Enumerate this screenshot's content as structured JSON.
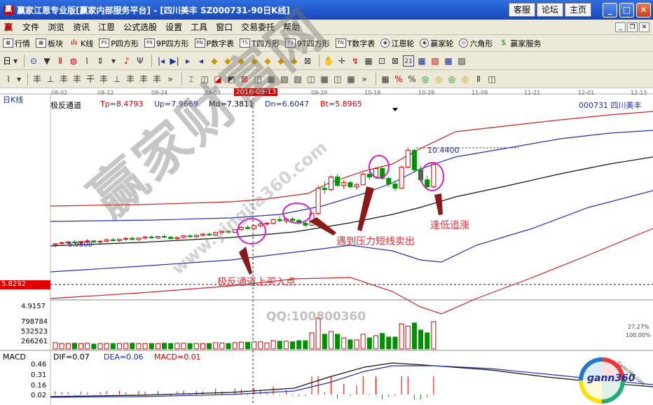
{
  "window": {
    "title": "赢家江恩专业版[赢家内部服务平台] - [四川美丰   SZ000731-90日K线]",
    "buttons": [
      "客服",
      "论坛",
      "主页"
    ]
  },
  "menu": {
    "items": [
      "文件",
      "浏览",
      "资讯",
      "江恩",
      "公式选股",
      "设置",
      "工具",
      "窗口",
      "交易委托",
      "帮助"
    ]
  },
  "toolbar1": {
    "items": [
      {
        "icon": "grid",
        "label": "行情"
      },
      {
        "icon": "blocks",
        "label": "板块"
      },
      {
        "icon": "kline",
        "label": "K线"
      },
      {
        "icon": "P",
        "label": "P四方形"
      },
      {
        "icon": "9P",
        "label": "9P四方形"
      },
      {
        "icon": "P",
        "label": "P数字表"
      },
      {
        "icon": "T",
        "label": "T四方形"
      },
      {
        "icon": "T9",
        "label": "9T四方形"
      },
      {
        "icon": "TN",
        "label": "T数字表"
      },
      {
        "icon": "wheel",
        "label": "江恩轮"
      },
      {
        "icon": "wheel",
        "label": "赢家轮"
      },
      {
        "icon": "hex",
        "label": "六角形"
      },
      {
        "icon": "$",
        "label": "赢家服务"
      }
    ]
  },
  "toolbar2": {
    "period": "日",
    "glyphs": [
      "⊙",
      "▼",
      "Ⅱ",
      "◍",
      "⌇",
      "⇕",
      "▾",
      "♪",
      "Ψ",
      "|◂",
      "▶|",
      "▸",
      "◂",
      "◆",
      "◆",
      "◆",
      "◆",
      "◆",
      "◆",
      "◆",
      "⊠",
      "✋",
      "✛",
      "↯",
      "▦",
      "⊡",
      "⊠",
      "21",
      "▦",
      "▧",
      "▩",
      "▨"
    ]
  },
  "toolbar3": {
    "glyphs": [
      "⌇",
      "▾",
      "丰",
      "⊥",
      "丰",
      "丰",
      "干",
      "丰",
      "⊥",
      "丰",
      "丰",
      "丰",
      "»",
      "⌶",
      "◫",
      "◪",
      "◩",
      "⊠",
      "◫",
      "▦",
      "▧",
      "▧",
      "◫",
      "▩",
      "◫",
      "▦",
      "»",
      "▦",
      "%",
      "%",
      "◎",
      "◎",
      "◎",
      "◎",
      "Ⅱ",
      "◫"
    ]
  },
  "chart": {
    "period_label": "日K线",
    "indicator_name": "极反通道",
    "tp": "Tp=8.4793",
    "up": "Up=7.9669",
    "md": "Md=7.3811",
    "dn": "Dn=6.6047",
    "bt": "Bt=5.8965",
    "stock": "000731  四川美丰",
    "dates": [
      "08-02",
      "08-12",
      "08-24",
      "09-05",
      "2016-09-13",
      "09-29",
      "10-18",
      "10-28",
      "11-09",
      "11-21",
      "12-01",
      "12-13"
    ],
    "high_label": "10.4400",
    "low_label": "6.9800",
    "cursor_price": "5.8292",
    "axis_price": "4.9157",
    "volume_ticks": [
      "798784",
      "532523",
      "266261"
    ],
    "pct_top": "27.27%",
    "pct_bottom": "100.00%",
    "watermark_main": "赢家财富网",
    "watermark_url": "www.yingjia360.com",
    "qq": "QQ:100800360",
    "annotations": {
      "buy_entry": "极反通道上买入点",
      "sell_pressure": "遇到压力短线卖出",
      "dip_buy": "逢低追涨"
    },
    "macd": {
      "name": "MACD",
      "dif": "DIF=0.07",
      "dea": "DEA=0.06",
      "macd": "MACD=0.01",
      "ticks": [
        "0.46",
        "0.31",
        "0.16",
        "0.02"
      ]
    },
    "logo": "gann360",
    "logo_ring": "Gann360.com"
  },
  "chart_data": {
    "type": "candlestick",
    "candles": [
      {
        "o": 6.98,
        "h": 7.05,
        "l": 6.9,
        "c": 7.02
      },
      {
        "o": 7.02,
        "h": 7.1,
        "l": 6.98,
        "c": 7.05
      },
      {
        "o": 7.05,
        "h": 7.12,
        "l": 7.0,
        "c": 7.08
      },
      {
        "o": 7.08,
        "h": 7.15,
        "l": 7.02,
        "c": 7.06
      },
      {
        "o": 7.06,
        "h": 7.12,
        "l": 7.0,
        "c": 7.1
      },
      {
        "o": 7.1,
        "h": 7.18,
        "l": 7.05,
        "c": 7.12
      },
      {
        "o": 7.12,
        "h": 7.15,
        "l": 7.05,
        "c": 7.08
      },
      {
        "o": 7.08,
        "h": 7.14,
        "l": 7.02,
        "c": 7.11
      },
      {
        "o": 7.11,
        "h": 7.2,
        "l": 7.08,
        "c": 7.16
      },
      {
        "o": 7.16,
        "h": 7.22,
        "l": 7.1,
        "c": 7.13
      },
      {
        "o": 7.13,
        "h": 7.2,
        "l": 7.08,
        "c": 7.18
      },
      {
        "o": 7.18,
        "h": 7.25,
        "l": 7.12,
        "c": 7.21
      },
      {
        "o": 7.21,
        "h": 7.28,
        "l": 7.15,
        "c": 7.17
      },
      {
        "o": 7.17,
        "h": 7.24,
        "l": 7.12,
        "c": 7.22
      },
      {
        "o": 7.22,
        "h": 7.3,
        "l": 7.18,
        "c": 7.26
      },
      {
        "o": 7.26,
        "h": 7.32,
        "l": 7.2,
        "c": 7.23
      },
      {
        "o": 7.23,
        "h": 7.3,
        "l": 7.18,
        "c": 7.28
      },
      {
        "o": 7.28,
        "h": 7.35,
        "l": 7.22,
        "c": 7.25
      },
      {
        "o": 7.25,
        "h": 7.3,
        "l": 7.18,
        "c": 7.2
      },
      {
        "o": 7.2,
        "h": 7.28,
        "l": 7.15,
        "c": 7.24
      },
      {
        "o": 7.24,
        "h": 7.33,
        "l": 7.2,
        "c": 7.3
      },
      {
        "o": 7.3,
        "h": 7.36,
        "l": 7.24,
        "c": 7.27
      },
      {
        "o": 7.27,
        "h": 7.34,
        "l": 7.22,
        "c": 7.32
      },
      {
        "o": 7.32,
        "h": 7.4,
        "l": 7.28,
        "c": 7.36
      },
      {
        "o": 7.36,
        "h": 7.42,
        "l": 7.3,
        "c": 7.33
      },
      {
        "o": 7.33,
        "h": 7.45,
        "l": 7.3,
        "c": 7.42
      },
      {
        "o": 7.42,
        "h": 7.5,
        "l": 7.36,
        "c": 7.46
      },
      {
        "o": 7.46,
        "h": 7.52,
        "l": 7.4,
        "c": 7.43
      },
      {
        "o": 7.43,
        "h": 7.55,
        "l": 7.4,
        "c": 7.52
      },
      {
        "o": 7.52,
        "h": 7.65,
        "l": 7.48,
        "c": 7.6
      },
      {
        "o": 7.6,
        "h": 7.68,
        "l": 7.52,
        "c": 7.56
      },
      {
        "o": 7.56,
        "h": 7.7,
        "l": 7.52,
        "c": 7.66
      },
      {
        "o": 7.66,
        "h": 7.78,
        "l": 7.6,
        "c": 7.72
      },
      {
        "o": 7.72,
        "h": 7.8,
        "l": 7.66,
        "c": 7.75
      },
      {
        "o": 7.75,
        "h": 7.92,
        "l": 7.7,
        "c": 7.88
      },
      {
        "o": 7.88,
        "h": 8.0,
        "l": 7.8,
        "c": 7.84
      },
      {
        "o": 7.84,
        "h": 7.95,
        "l": 7.75,
        "c": 7.9
      },
      {
        "o": 7.9,
        "h": 7.98,
        "l": 7.8,
        "c": 7.85
      },
      {
        "o": 7.85,
        "h": 7.92,
        "l": 7.7,
        "c": 7.75
      },
      {
        "o": 7.75,
        "h": 7.82,
        "l": 7.6,
        "c": 7.68
      },
      {
        "o": 7.68,
        "h": 8.15,
        "l": 7.65,
        "c": 8.1
      },
      {
        "o": 8.1,
        "h": 9.1,
        "l": 8.05,
        "c": 9.0
      },
      {
        "o": 9.0,
        "h": 9.25,
        "l": 8.8,
        "c": 8.95
      },
      {
        "o": 8.95,
        "h": 9.45,
        "l": 8.9,
        "c": 9.4
      },
      {
        "o": 9.4,
        "h": 9.5,
        "l": 9.05,
        "c": 9.1
      },
      {
        "o": 9.1,
        "h": 9.3,
        "l": 8.98,
        "c": 9.2
      },
      {
        "o": 9.2,
        "h": 9.25,
        "l": 9.0,
        "c": 9.05
      },
      {
        "o": 9.05,
        "h": 9.2,
        "l": 8.95,
        "c": 9.12
      },
      {
        "o": 9.12,
        "h": 9.55,
        "l": 9.1,
        "c": 9.5
      },
      {
        "o": 9.5,
        "h": 9.62,
        "l": 9.3,
        "c": 9.4
      },
      {
        "o": 9.4,
        "h": 9.75,
        "l": 9.35,
        "c": 9.7
      },
      {
        "o": 9.7,
        "h": 9.78,
        "l": 9.3,
        "c": 9.35
      },
      {
        "o": 9.35,
        "h": 9.4,
        "l": 9.05,
        "c": 9.15
      },
      {
        "o": 9.15,
        "h": 9.25,
        "l": 8.9,
        "c": 9.0
      },
      {
        "o": 9.0,
        "h": 9.8,
        "l": 8.98,
        "c": 9.75
      },
      {
        "o": 9.75,
        "h": 10.44,
        "l": 9.7,
        "c": 10.35
      },
      {
        "o": 10.35,
        "h": 10.4,
        "l": 9.55,
        "c": 9.65
      },
      {
        "o": 9.65,
        "h": 9.8,
        "l": 9.2,
        "c": 9.3
      },
      {
        "o": 9.3,
        "h": 9.45,
        "l": 8.95,
        "c": 9.05
      },
      {
        "o": 9.05,
        "h": 9.9,
        "l": 9.0,
        "c": 9.85
      }
    ],
    "volume_ticks": [
      266261,
      532523,
      798784
    ],
    "macd_ticks": [
      0.02,
      0.16,
      0.31,
      0.46
    ]
  }
}
